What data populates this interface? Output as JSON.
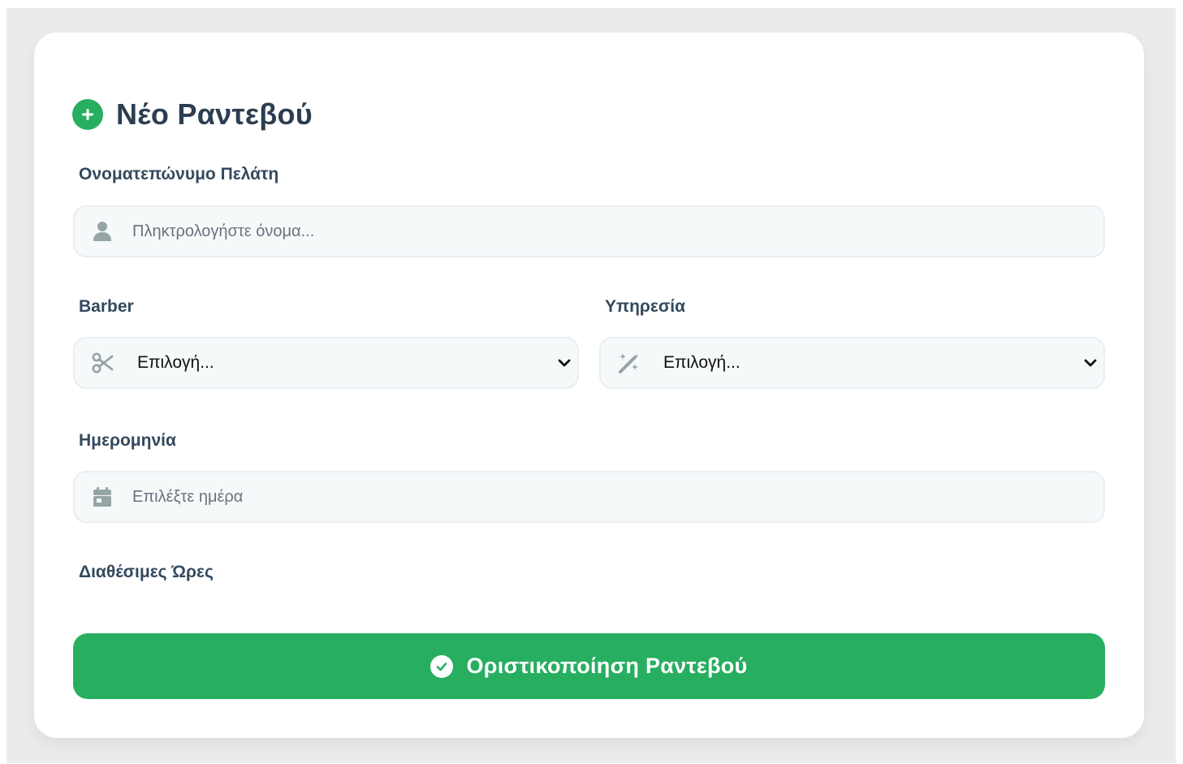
{
  "form": {
    "title": "Νέο Ραντεβού",
    "title_icon": "plus-circle-icon",
    "customer_name": {
      "label": "Ονοματεπώνυμο Πελάτη",
      "placeholder": "Πληκτρολογήστε όνομα...",
      "value": "",
      "icon": "user-icon"
    },
    "barber": {
      "label": "Barber",
      "selected": "Επιλογή...",
      "icon": "scissors-icon"
    },
    "service": {
      "label": "Υπηρεσία",
      "selected": "Επιλογή...",
      "icon": "magic-wand-icon"
    },
    "date": {
      "label": "Ημερομηνία",
      "placeholder": "Επιλέξτε ημέρα",
      "icon": "calendar-icon"
    },
    "available_hours": {
      "label": "Διαθέσιμες Ώρες"
    },
    "submit": {
      "label": "Οριστικοποίηση Ραντεβού",
      "icon": "check-circle-icon"
    }
  },
  "colors": {
    "accent": "#27ae60",
    "title_text": "#2c3e50",
    "label_text": "#34495e",
    "field_bg": "#f5f9fa",
    "icon_gray": "#95a5a6"
  }
}
